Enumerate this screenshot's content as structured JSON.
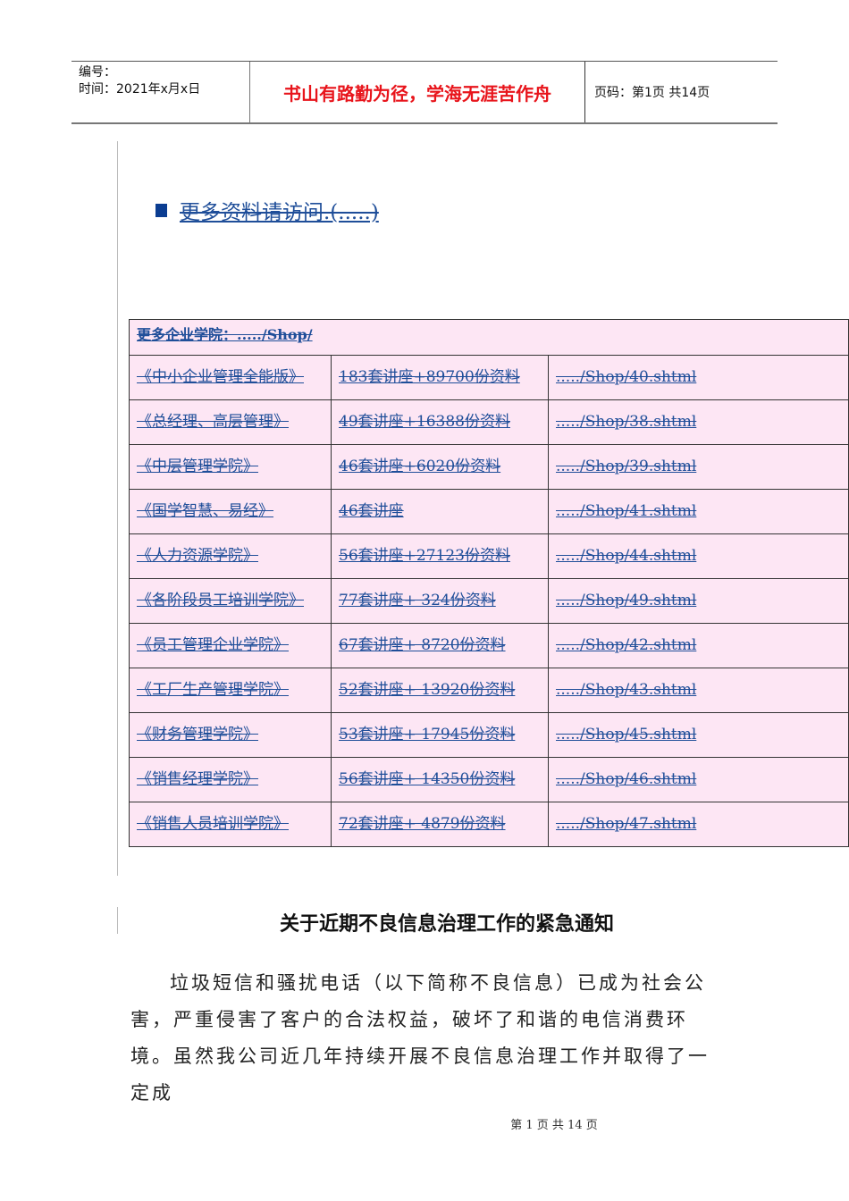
{
  "header": {
    "number_label": "编号：",
    "time_label": "时间：2021年x月x日",
    "motto": "书山有路勤为径，学海无涯苦作舟",
    "page_info": "页码：第1页  共14页"
  },
  "more_link": "更多资料请访问.(.....)",
  "table": {
    "header": "更多企业学院：...../Shop/",
    "rows": [
      [
        "《中小企业管理全能版》",
        "183套讲座+89700份资料",
        "...../Shop/40.shtml"
      ],
      [
        "《总经理、高层管理》",
        "49套讲座+16388份资料",
        "...../Shop/38.shtml"
      ],
      [
        "《中层管理学院》",
        "46套讲座+6020份资料",
        "...../Shop/39.shtml"
      ],
      [
        "《国学智慧、易经》",
        "46套讲座",
        "...../Shop/41.shtml"
      ],
      [
        "《人力资源学院》",
        "56套讲座+27123份资料",
        "...../Shop/44.shtml"
      ],
      [
        "《各阶段员工培训学院》",
        "77套讲座+ 324份资料",
        "...../Shop/49.shtml"
      ],
      [
        "《员工管理企业学院》",
        "67套讲座+ 8720份资料",
        "...../Shop/42.shtml"
      ],
      [
        "《工厂生产管理学院》",
        "52套讲座+ 13920份资料",
        "...../Shop/43.shtml"
      ],
      [
        "《财务管理学院》",
        "53套讲座+ 17945份资料",
        "...../Shop/45.shtml"
      ],
      [
        "《销售经理学院》",
        "56套讲座+ 14350份资料",
        "...../Shop/46.shtml"
      ],
      [
        "《销售人员培训学院》",
        "72套讲座+ 4879份资料",
        "...../Shop/47.shtml"
      ]
    ]
  },
  "doc_title": "关于近期不良信息治理工作的紧急通知",
  "body": "垃圾短信和骚扰电话（以下简称不良信息）已成为社会公害，严重侵害了客户的合法权益，破坏了和谐的电信消费环境。虽然我公司近几年持续开展不良信息治理工作并取得了一定成",
  "footer": "第 1 页 共 14 页"
}
